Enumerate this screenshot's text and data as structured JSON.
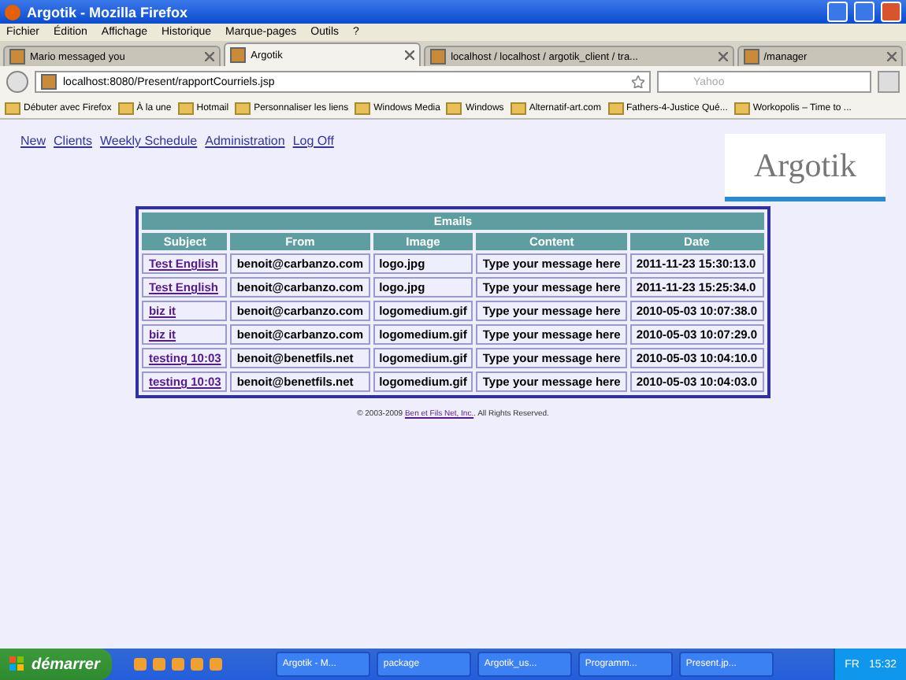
{
  "window": {
    "title": "Argotik - Mozilla Firefox"
  },
  "menu": [
    "Fichier",
    "Édition",
    "Affichage",
    "Historique",
    "Marque-pages",
    "Outils",
    "?"
  ],
  "tabs": [
    {
      "label": "Mario messaged you",
      "selected": false
    },
    {
      "label": "Argotik",
      "selected": true
    },
    {
      "label": "localhost / localhost / argotik_client / tra...",
      "selected": false
    },
    {
      "label": "/manager",
      "selected": false
    }
  ],
  "address": "localhost:8080/Present/rapportCourriels.jsp",
  "search": {
    "placeholder": "Yahoo"
  },
  "bookmarks": [
    "Débuter avec Firefox",
    "À la une",
    "Hotmail",
    "Personnaliser les liens",
    "Windows Media",
    "Windows",
    "Alternatif-art.com",
    "Fathers-4-Justice Qué...",
    "Workopolis – Time to ..."
  ],
  "nav": [
    "New",
    "Clients",
    "Weekly Schedule",
    "Administration",
    "Log Off"
  ],
  "logo": "Argotik",
  "table": {
    "title": "Emails",
    "columns": [
      "Subject",
      "From",
      "Image",
      "Content",
      "Date"
    ],
    "rows": [
      [
        "Test English",
        "benoit@carbanzo.com",
        "logo.jpg",
        "Type your message here",
        "2011-11-23 15:30:13.0"
      ],
      [
        "Test English",
        "benoit@carbanzo.com",
        "logo.jpg",
        "Type your message here",
        "2011-11-23 15:25:34.0"
      ],
      [
        "biz it",
        "benoit@carbanzo.com",
        "logomedium.gif",
        "Type your message here",
        "2010-05-03 10:07:38.0"
      ],
      [
        "biz it",
        "benoit@carbanzo.com",
        "logomedium.gif",
        "Type your message here",
        "2010-05-03 10:07:29.0"
      ],
      [
        "testing 10:03",
        "benoit@benetfils.net",
        "logomedium.gif",
        "Type your message here",
        "2010-05-03 10:04:10.0"
      ],
      [
        "testing 10:03",
        "benoit@benetfils.net",
        "logomedium.gif",
        "Type your message here",
        "2010-05-03 10:04:03.0"
      ]
    ]
  },
  "footer": {
    "prefix": "© 2003-2009",
    "link": "Ben et Fils Net, Inc.",
    "suffix": ". All Rights Reserved."
  },
  "taskbar": {
    "start": "démarrer",
    "tasks": [
      "Argotik - M...",
      "package",
      "Argotik_us...",
      "Programm...",
      "Present.jp..."
    ],
    "lang": "FR",
    "clock": "15:32"
  }
}
